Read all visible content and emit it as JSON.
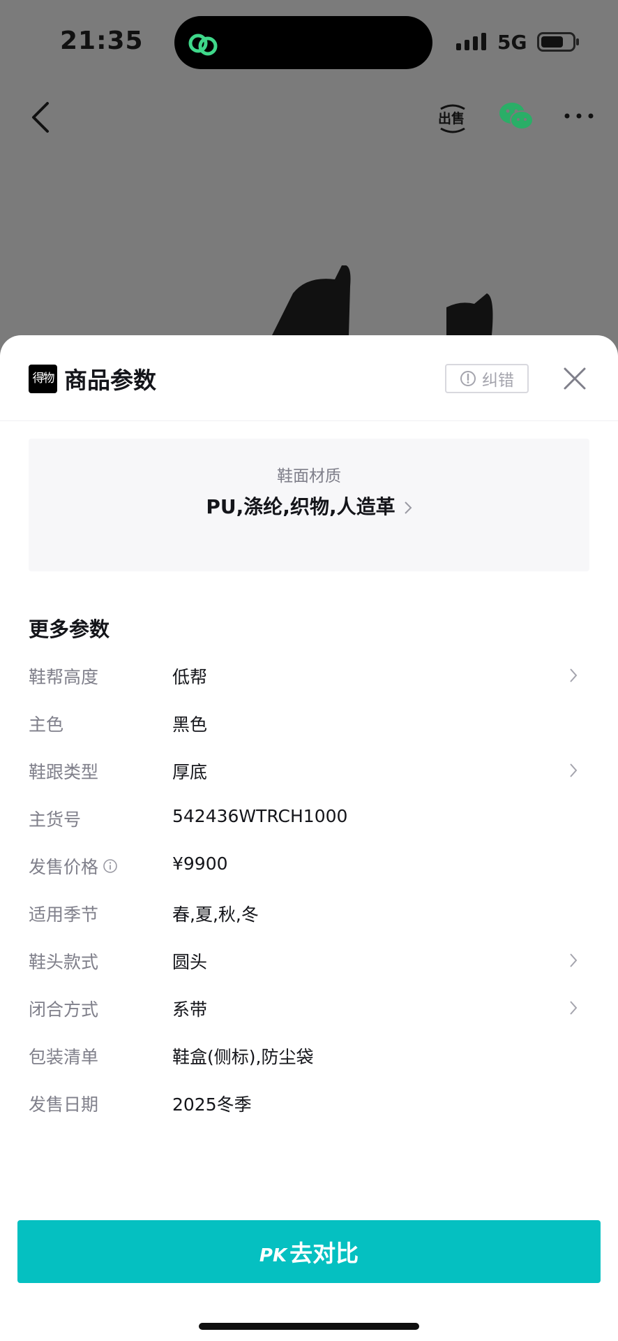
{
  "status_bar": {
    "time": "21:35",
    "network": "5G"
  },
  "nav": {
    "sell_icon": "sell-icon",
    "share_icon": "wechat-icon"
  },
  "sheet": {
    "logo_text": "得物",
    "title": "商品参数",
    "report_label": "纠错",
    "material": {
      "label": "鞋面材质",
      "value": "PU,涤纶,织物,人造革"
    },
    "more_title": "更多参数",
    "params": [
      {
        "key": "鞋帮高度",
        "value": "低帮",
        "chevron": true,
        "info": false
      },
      {
        "key": "主色",
        "value": "黑色",
        "chevron": false,
        "info": false
      },
      {
        "key": "鞋跟类型",
        "value": "厚底",
        "chevron": true,
        "info": false
      },
      {
        "key": "主货号",
        "value": "542436WTRCH1000",
        "chevron": false,
        "info": false
      },
      {
        "key": "发售价格",
        "value": "¥9900",
        "chevron": false,
        "info": true
      },
      {
        "key": "适用季节",
        "value": "春,夏,秋,冬",
        "chevron": false,
        "info": false
      },
      {
        "key": "鞋头款式",
        "value": "圆头",
        "chevron": true,
        "info": false
      },
      {
        "key": "闭合方式",
        "value": "系带",
        "chevron": true,
        "info": false
      },
      {
        "key": "包装清单",
        "value": "鞋盒(侧标),防尘袋",
        "chevron": false,
        "info": false
      },
      {
        "key": "发售日期",
        "value": "2025冬季",
        "chevron": false,
        "info": false
      }
    ],
    "pk_prefix": "PK",
    "pk_label": "去对比"
  },
  "colors": {
    "accent": "#05c0c1",
    "backdrop": "#7b7b7b"
  }
}
